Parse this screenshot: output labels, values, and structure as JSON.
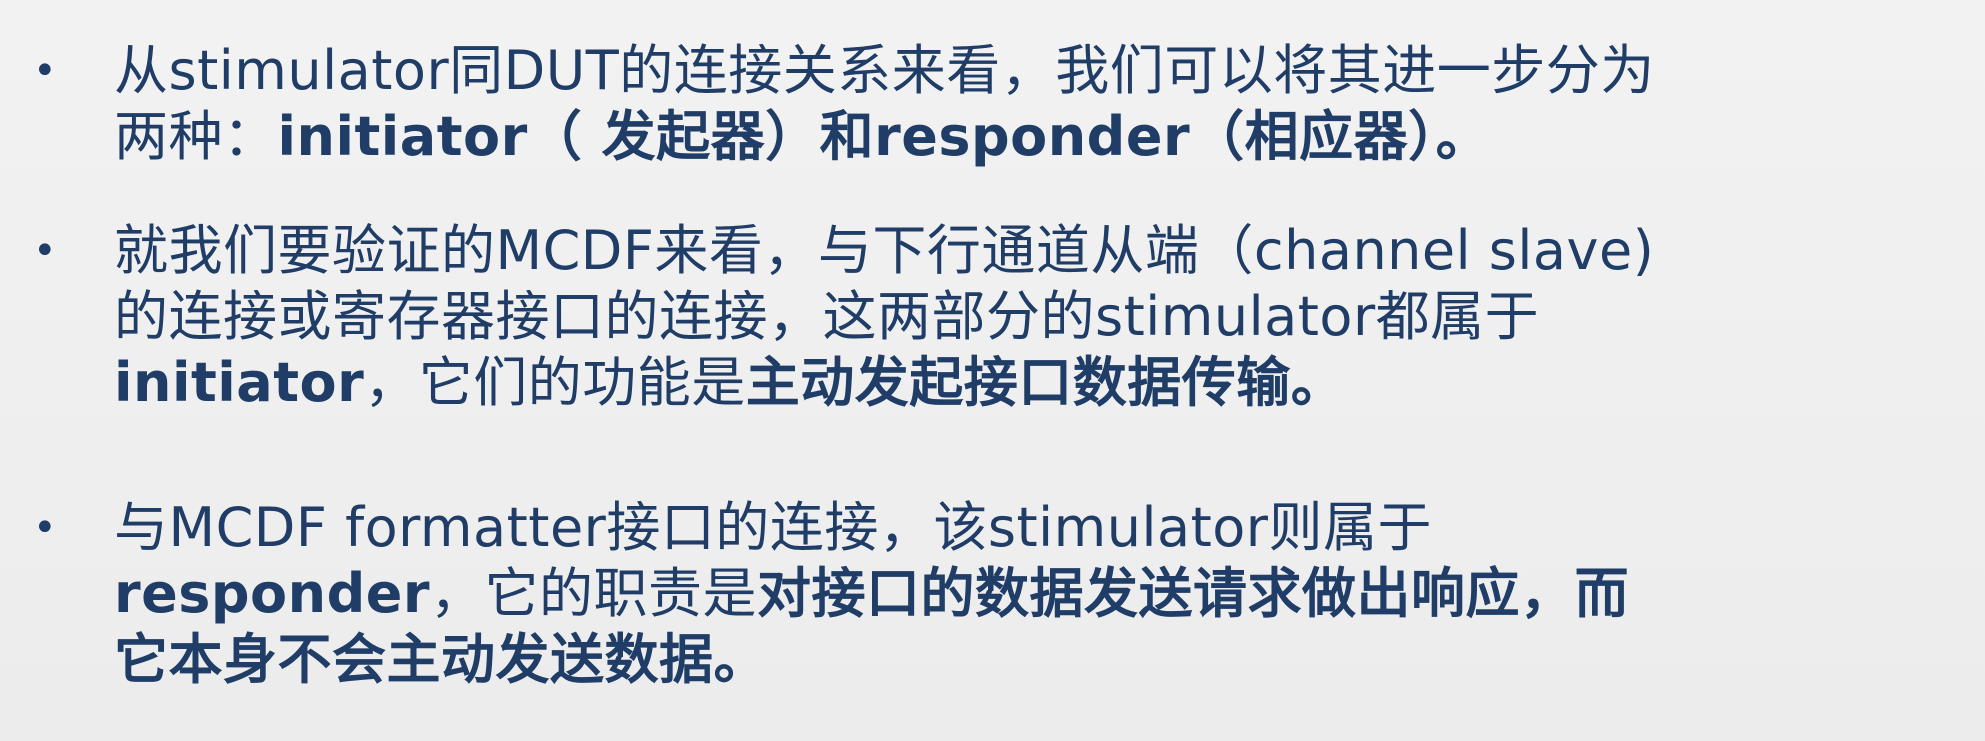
{
  "bullets": [
    {
      "lines": [
        [
          {
            "text": "从stimulator同DUT的连接关系来看，我们可以将其进一步分为",
            "bold": false
          }
        ],
        [
          {
            "text": "两种：",
            "bold": false
          },
          {
            "text": "initiator（ 发起器）和responder（相应器）。",
            "bold": true
          }
        ]
      ]
    },
    {
      "lines": [
        [
          {
            "text": "就我们要验证的MCDF来看，与下行通道从端（channel slave)",
            "bold": false
          }
        ],
        [
          {
            "text": "的连接或寄存器接口的连接，这两部分的stimulator都属于",
            "bold": false
          }
        ],
        [
          {
            "text": "initiator",
            "bold": true
          },
          {
            "text": "，它们的功能是",
            "bold": false
          },
          {
            "text": "主动发起接口数据传输。",
            "bold": true
          }
        ]
      ]
    },
    {
      "lines": [
        [
          {
            "text": "与MCDF formatter接口的连接，该stimulator则属于",
            "bold": false
          }
        ],
        [
          {
            "text": "responder",
            "bold": true
          },
          {
            "text": "，它的职责是",
            "bold": false
          },
          {
            "text": "对接口的数据发送请求做出响应，而",
            "bold": true
          }
        ],
        [
          {
            "text": "它本身不会主动发送数据。",
            "bold": true
          }
        ]
      ]
    }
  ],
  "bullet_symbol": "•",
  "colors": {
    "text": "#1f3d66",
    "background": "#f0f0f0"
  }
}
